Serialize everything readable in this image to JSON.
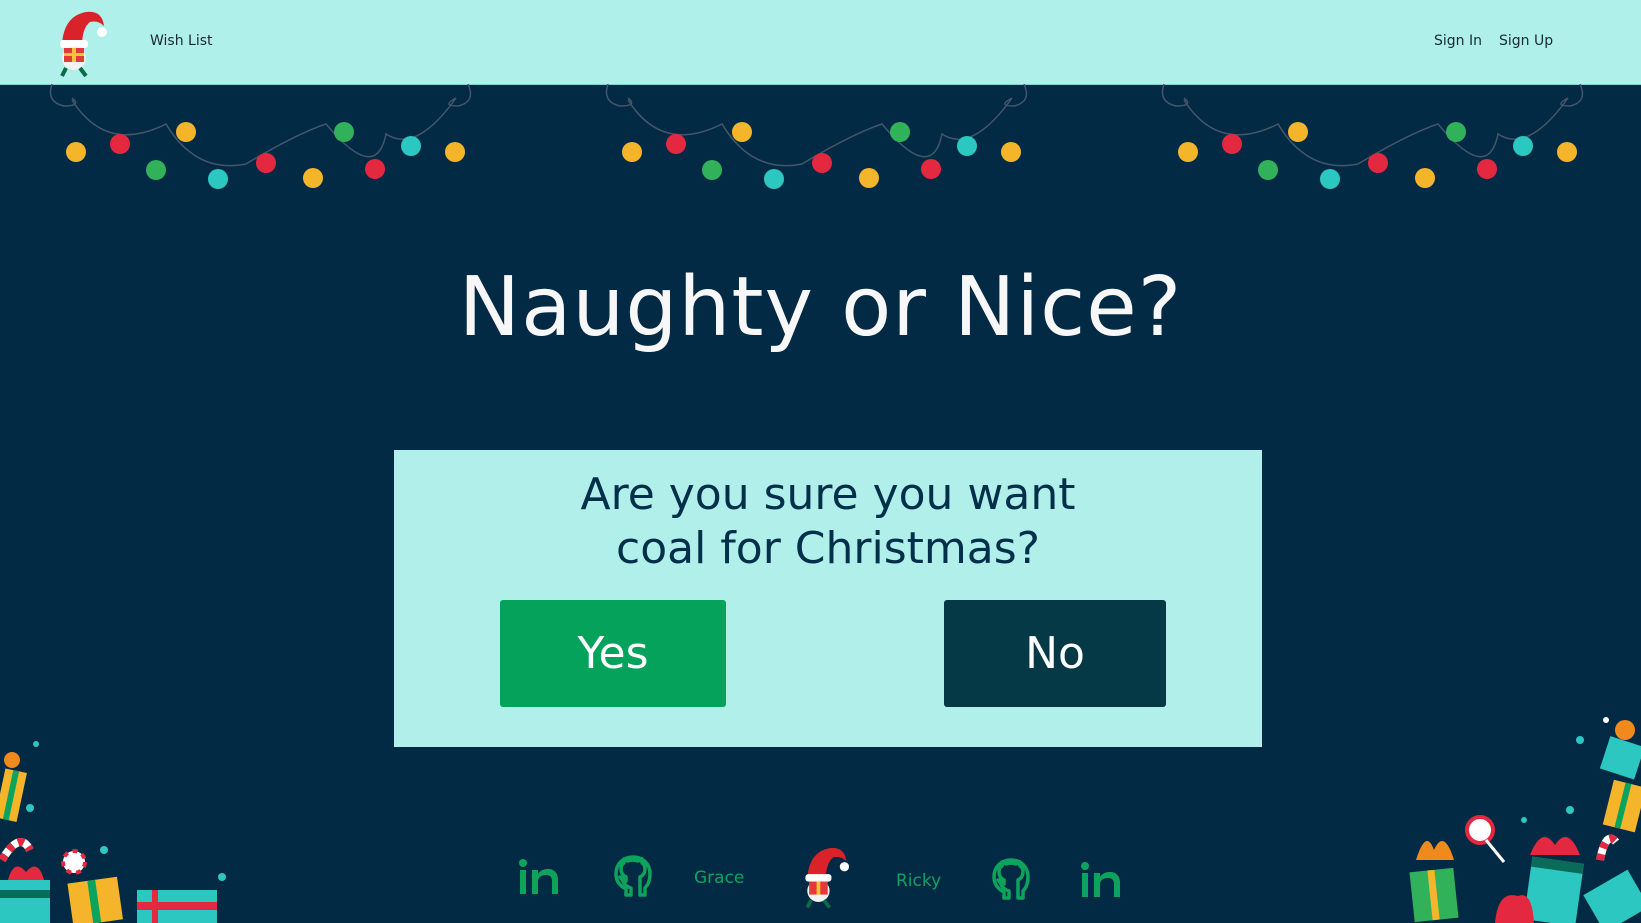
{
  "navbar": {
    "logo_icon": "gnome-logo-icon",
    "wish_list": "Wish List",
    "sign_in": "Sign In",
    "sign_up": "Sign Up",
    "background": "#aff0ea"
  },
  "heading": {
    "title": "Naughty or Nice?"
  },
  "dialog": {
    "question_line1": "Are you sure you want",
    "question_line2": "coal for Christmas?",
    "yes_label": "Yes",
    "no_label": "No",
    "yes_color": "#04a25a",
    "no_color": "#043945",
    "background": "#b0efea"
  },
  "footer": {
    "left_name": "Grace",
    "right_name": "Ricky",
    "icons": [
      "linkedin-icon",
      "github-icon",
      "gnome-logo-icon",
      "github-icon",
      "linkedin-icon"
    ],
    "accent": "#0ea35d"
  },
  "colors": {
    "page_background": "#022a45",
    "title_text": "#f7f7f7"
  }
}
